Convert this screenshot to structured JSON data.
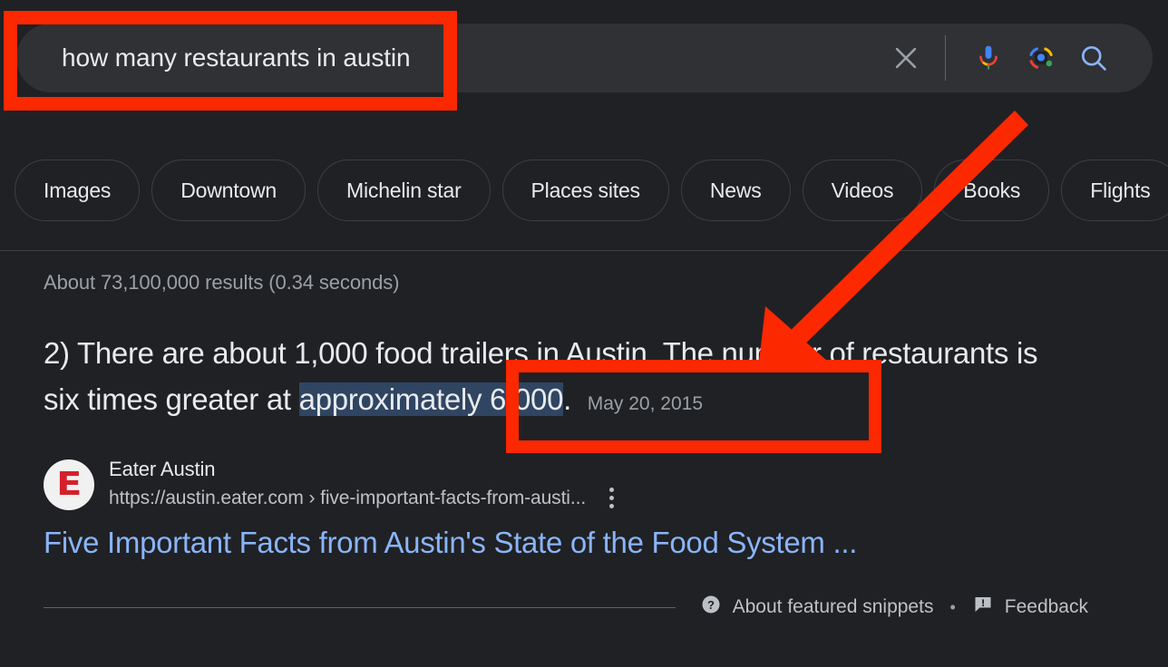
{
  "search": {
    "query": "how many restaurants in austin",
    "placeholder": "Search",
    "clear_label": "Clear",
    "voice_label": "Search by voice",
    "lens_label": "Search by image",
    "submit_label": "Google Search"
  },
  "filters": {
    "chips": [
      {
        "label": "Images"
      },
      {
        "label": "Downtown"
      },
      {
        "label": "Michelin star"
      },
      {
        "label": "Places sites"
      },
      {
        "label": "News"
      },
      {
        "label": "Videos"
      },
      {
        "label": "Books"
      },
      {
        "label": "Flights"
      },
      {
        "label": ""
      }
    ]
  },
  "results": {
    "count_text": "About 73,100,000 results (0.34 seconds)",
    "snippet": {
      "before_highlight": "2) There are about 1,000 food trailers in Austin. The number of restaurants is six times greater at ",
      "highlight": "approximately 6,000",
      "after_highlight": ".",
      "date": "May 20, 2015"
    },
    "source": {
      "favicon_letter": "E",
      "name": "Eater Austin",
      "url": "https://austin.eater.com › five-important-facts-from-austi...",
      "menu_label": "About this result"
    },
    "title": "Five Important Facts from Austin's State of the Food System ..."
  },
  "footer": {
    "about_snippets": "About featured snippets",
    "separator": "•",
    "feedback": "Feedback"
  },
  "annotations": {
    "search_box_label": "search-query-highlight",
    "answer_box_label": "answer-highlight",
    "arrow_label": "pointer-arrow",
    "color": "#fc2800"
  },
  "colors": {
    "page_background": "#202124",
    "search_field": "#303134",
    "primary_text": "#e8eaed",
    "secondary_text": "#9aa0a6",
    "link": "#8ab4f8",
    "selection_highlight": "#2f4562",
    "annotation_red": "#fc2800"
  }
}
